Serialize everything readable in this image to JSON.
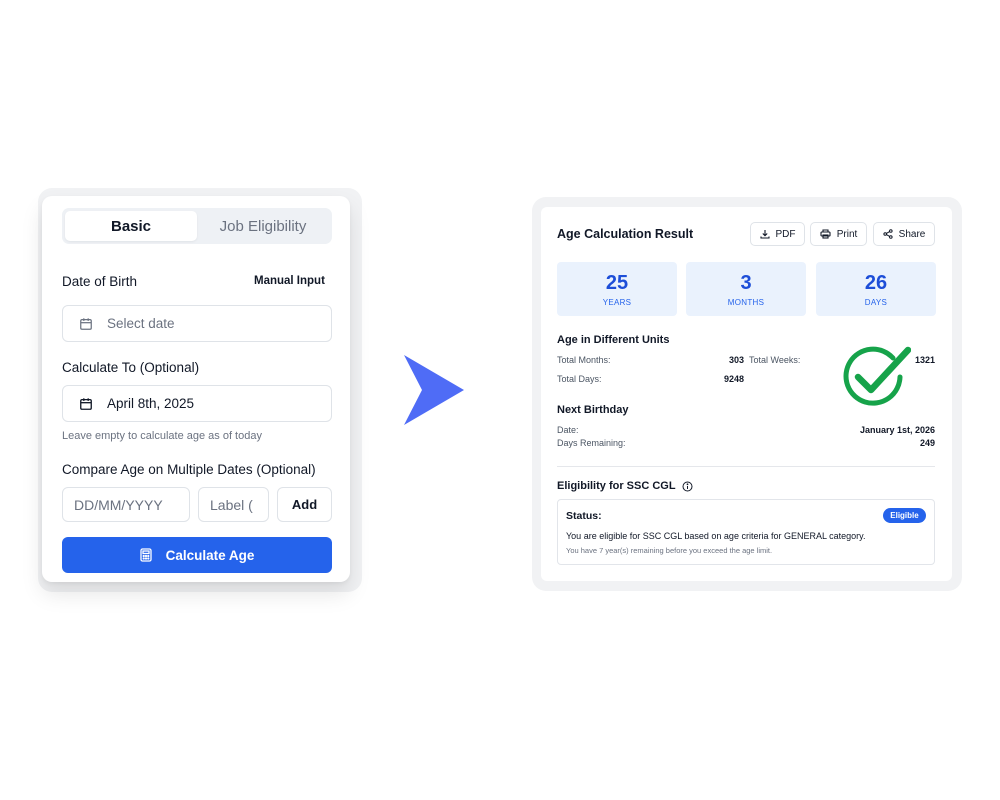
{
  "form": {
    "tabs": [
      {
        "label": "Basic",
        "active": true
      },
      {
        "label": "Job Eligibility",
        "active": false
      }
    ],
    "dob_label": "Date of Birth",
    "manual_input_label": "Manual Input",
    "dob_placeholder": "Select date",
    "calc_to_label": "Calculate To (Optional)",
    "calc_to_value": "April 8th, 2025",
    "calc_to_hint": "Leave empty to calculate age as of today",
    "compare_label": "Compare Age on Multiple Dates (Optional)",
    "compare_date_placeholder": "DD/MM/YYYY",
    "compare_label_placeholder": "Label (",
    "add_label": "Add",
    "submit_label": "Calculate Age"
  },
  "result": {
    "title": "Age Calculation Result",
    "actions": {
      "pdf": "PDF",
      "print": "Print",
      "share": "Share"
    },
    "summary": [
      {
        "value": "25",
        "unit": "YEARS"
      },
      {
        "value": "3",
        "unit": "MONTHS"
      },
      {
        "value": "26",
        "unit": "DAYS"
      }
    ],
    "units_title": "Age in Different Units",
    "units": {
      "total_months_label": "Total Months:",
      "total_months": "303",
      "total_weeks_label": "Total Weeks:",
      "total_weeks": "1321",
      "total_days_label": "Total Days:",
      "total_days": "9248"
    },
    "birthday_title": "Next Birthday",
    "birthday": {
      "date_label": "Date:",
      "date": "January 1st, 2026",
      "remaining_label": "Days Remaining:",
      "remaining": "249"
    },
    "eligibility_title": "Eligibility for SSC CGL",
    "status_label": "Status:",
    "status_badge": "Eligible",
    "status_message": "You are eligible for SSC CGL based on age criteria for GENERAL category.",
    "status_sub": "You have 7 year(s) remaining before you exceed the age limit."
  },
  "colors": {
    "primary": "#2563eb",
    "arrow": "#4f6cf6",
    "check": "#16a34a",
    "stat_bg": "#eaf2fd"
  },
  "icons": {
    "calendar": "calendar-icon",
    "calculator": "calculator-icon",
    "download": "download-icon",
    "printer": "printer-icon",
    "share": "share-icon",
    "info": "info-icon",
    "arrow": "play-arrow-icon",
    "check": "check-circle-icon"
  }
}
